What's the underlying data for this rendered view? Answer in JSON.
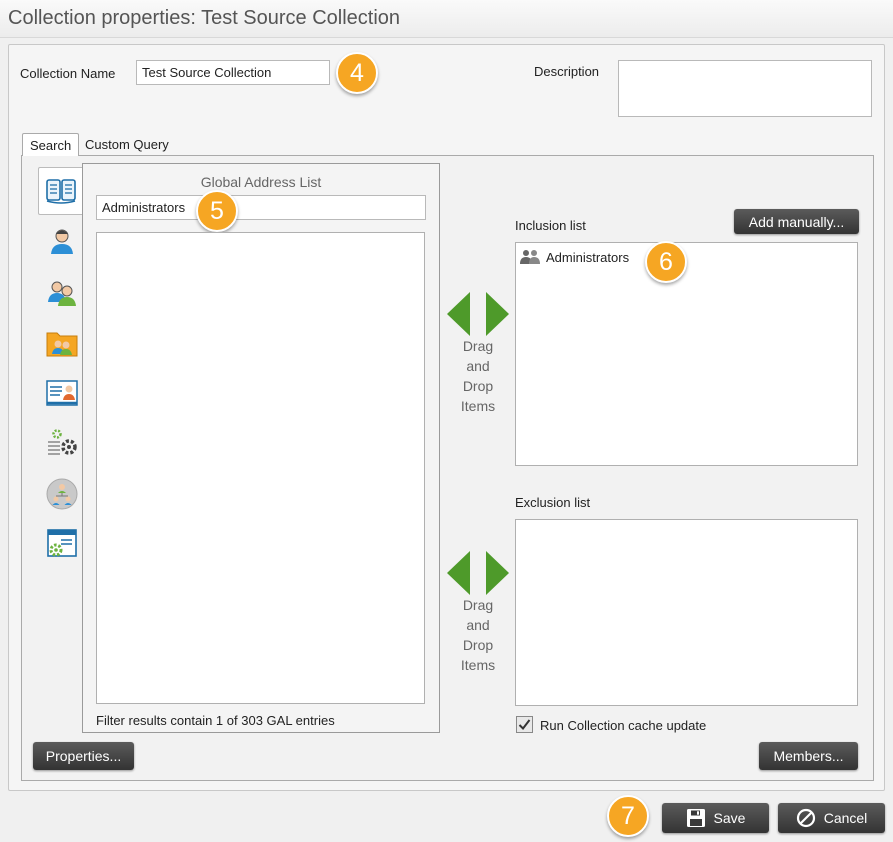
{
  "window": {
    "title": "Collection properties: Test Source Collection"
  },
  "form": {
    "collection_name_label": "Collection Name",
    "collection_name_value": "Test Source Collection",
    "description_label": "Description",
    "description_value": ""
  },
  "tabs": [
    {
      "label": "Search",
      "active": true
    },
    {
      "label": "Custom Query",
      "active": false
    }
  ],
  "side_icons": [
    "address-book-icon",
    "user-icon",
    "group-icon",
    "folder-contacts-icon",
    "contact-card-icon",
    "settings-list-icon",
    "org-chart-icon",
    "web-settings-icon"
  ],
  "gal": {
    "title": "Global Address List",
    "search_value": "Administrators",
    "filter_status": "Filter results contain 1 of 303 GAL entries"
  },
  "drag_drop": {
    "line1": "Drag",
    "line2": "and",
    "line3": "Drop",
    "line4": "Items"
  },
  "inclusion": {
    "label": "Inclusion list",
    "add_manually_label": "Add manually...",
    "items": [
      {
        "name": "Administrators",
        "icon": "group-icon"
      }
    ]
  },
  "exclusion": {
    "label": "Exclusion list",
    "items": []
  },
  "cache_update": {
    "label": "Run Collection cache update",
    "checked": true
  },
  "buttons": {
    "properties": "Properties...",
    "members": "Members...",
    "save": "Save",
    "cancel": "Cancel"
  },
  "callouts": {
    "name": "4",
    "search": "5",
    "inclusion": "6",
    "save": "7"
  },
  "colors": {
    "callout": "#f6a623",
    "arrow_green": "#4e9a2a",
    "button_dark": "#3c3c3c"
  }
}
